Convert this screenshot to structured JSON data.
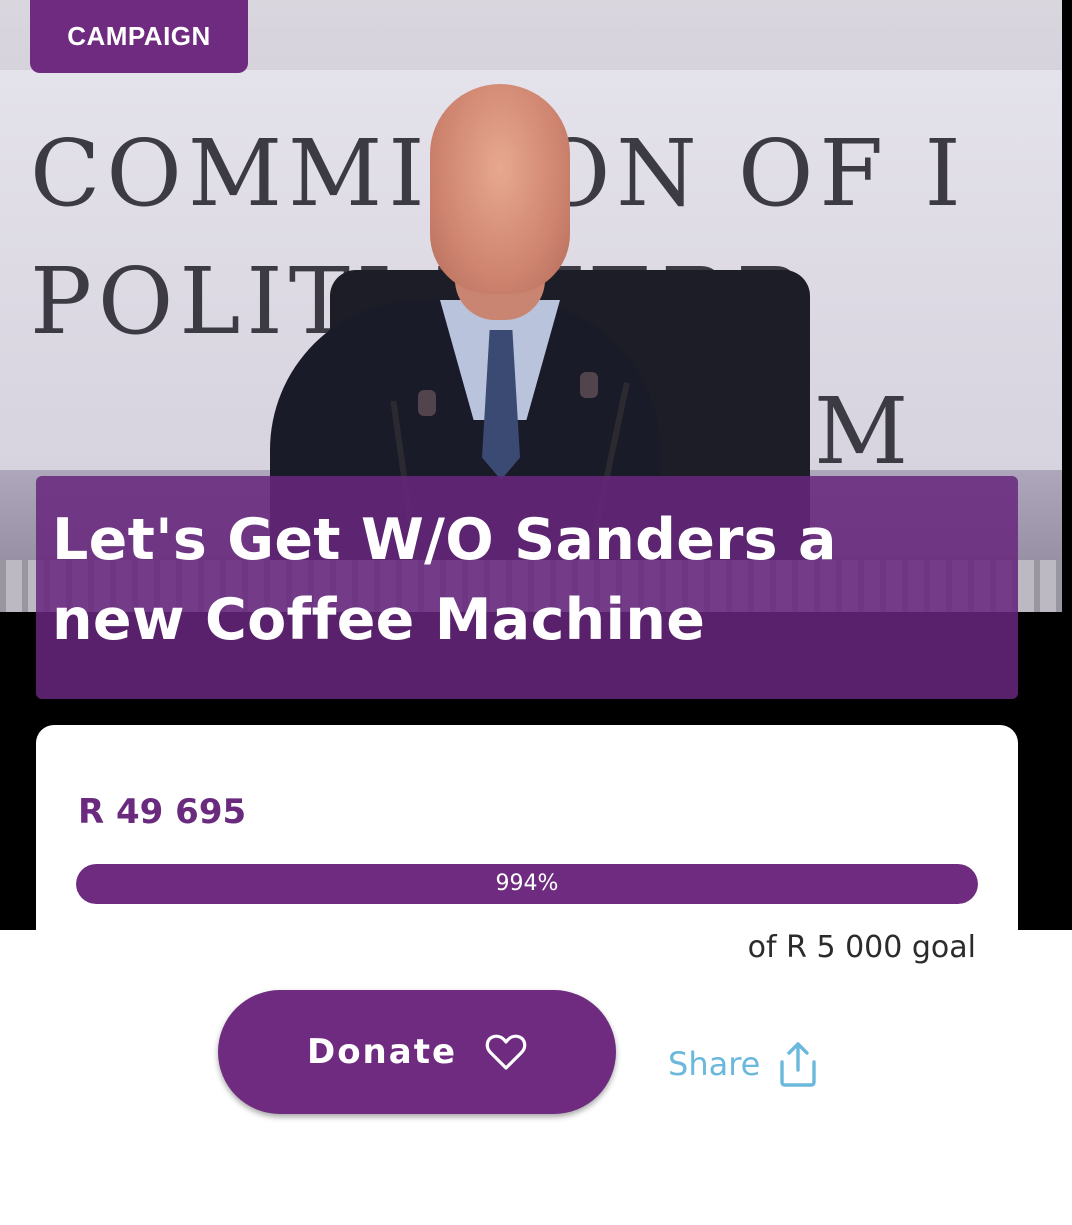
{
  "hero": {
    "badge_label": "CAMPAIGN",
    "banner_lines": [
      "COMMIS  ON OF I",
      "POLITI      NTERR",
      "CRIM"
    ],
    "title": "Let's Get W/O Sanders a new Coffee Machine"
  },
  "progress": {
    "raised": "R 49 695",
    "percent_label": "994%",
    "fill_fraction": 1.0,
    "goal_text": "of R 5 000 goal"
  },
  "actions": {
    "donate_label": "Donate",
    "donate_icon": "heart-icon",
    "share_label": "Share",
    "share_icon": "share-icon"
  },
  "colors": {
    "brand_purple": "#6e2b80",
    "share_blue": "#6ab8dc"
  }
}
